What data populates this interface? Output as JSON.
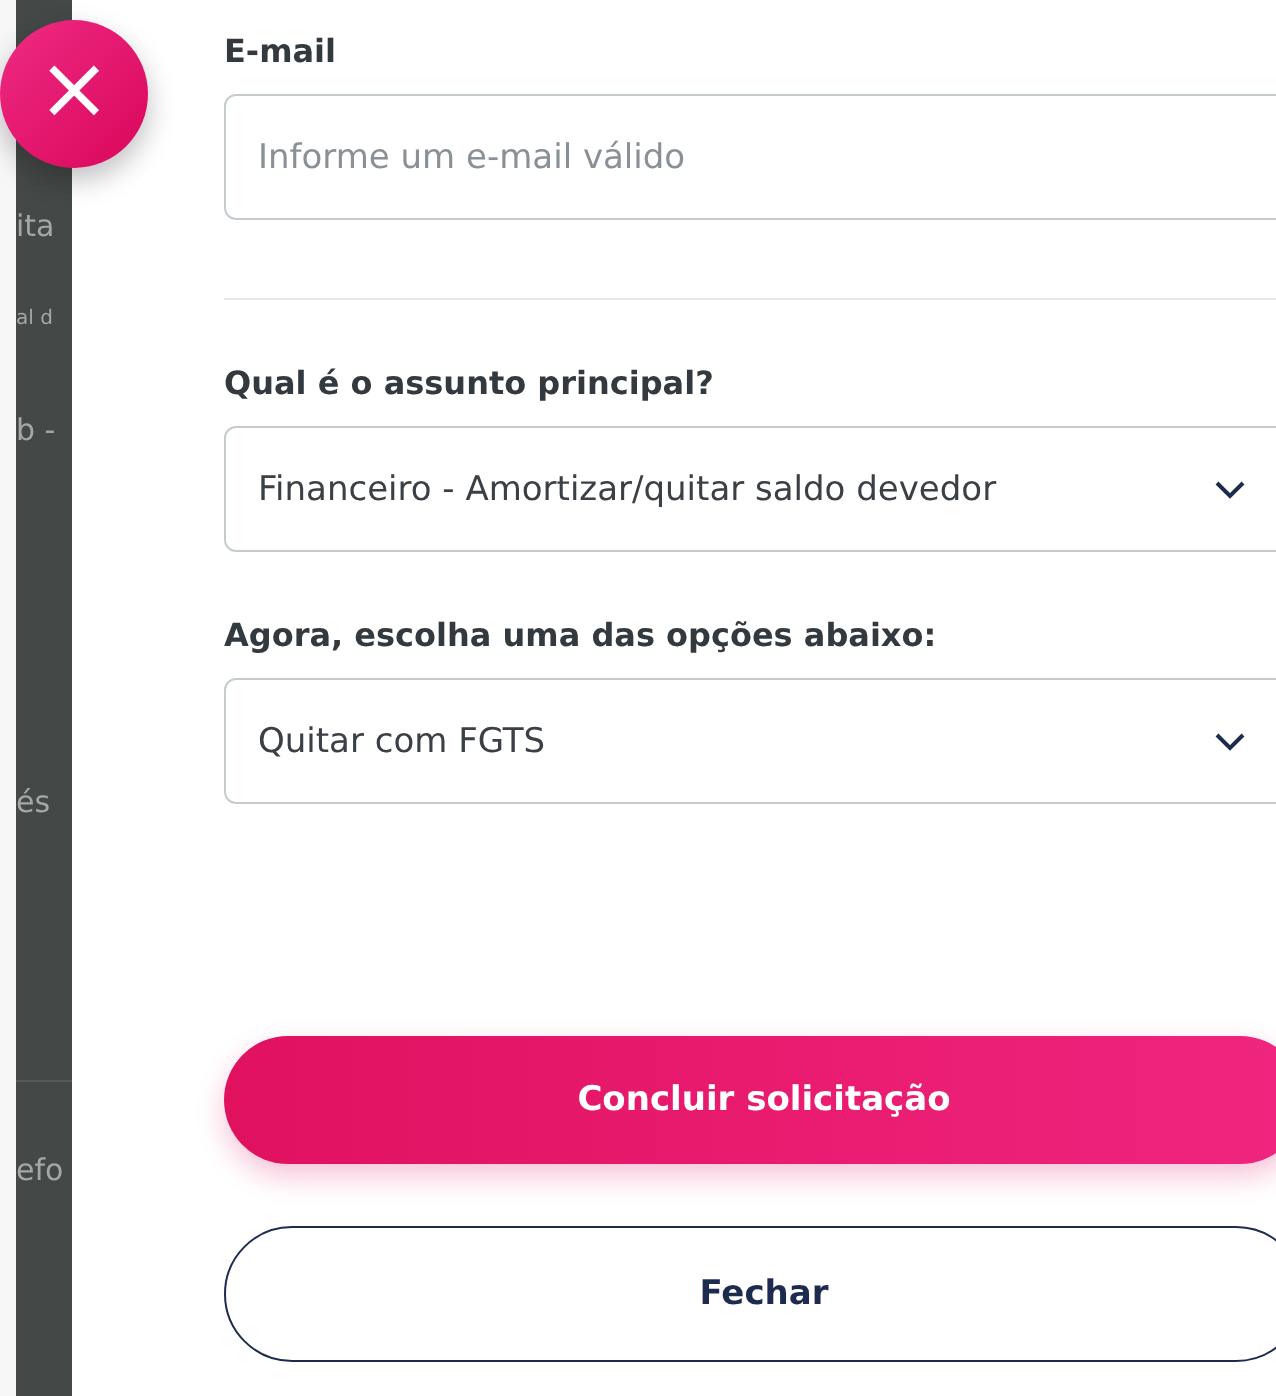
{
  "background_fragments": [
    "ita",
    "al d",
    "b -",
    "és",
    "efo"
  ],
  "close_button": {
    "label": "×"
  },
  "form": {
    "email": {
      "label": "E-mail",
      "placeholder": "Informe um e-mail válido"
    },
    "subject": {
      "label": "Qual é o assunto principal?",
      "value": "Financeiro - Amortizar/quitar saldo devedor"
    },
    "option": {
      "label": "Agora, escolha uma das opções abaixo:",
      "value": "Quitar com FGTS"
    }
  },
  "buttons": [
    {
      "kind": "primary",
      "label": "Concluir solicitação"
    },
    {
      "kind": "secondary",
      "label": "Fechar"
    }
  ]
}
